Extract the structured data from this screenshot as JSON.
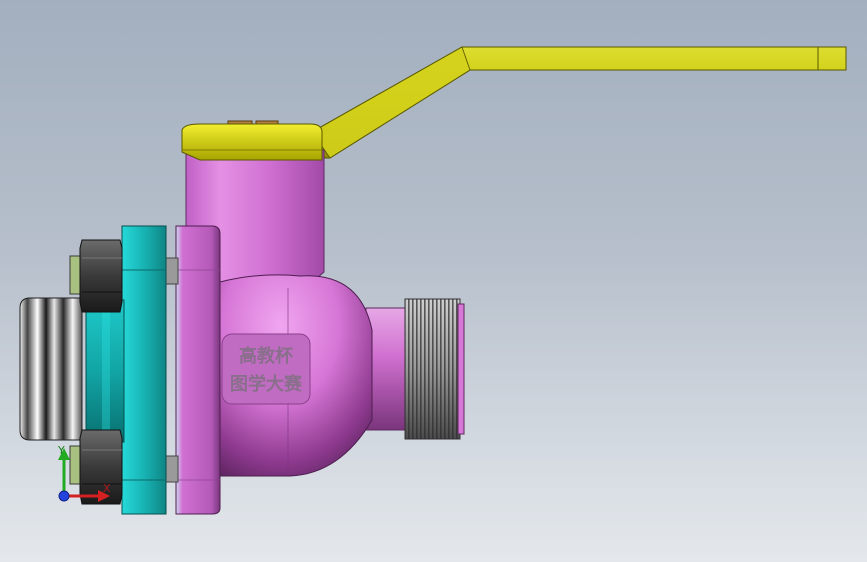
{
  "viewport": {
    "background_top": "#a3afbf",
    "background_bottom": "#e4e8ec"
  },
  "model": {
    "name": "ball-valve",
    "colors": {
      "handle": "#c4c200",
      "body": "#d777d6",
      "flange": "#19b8b8",
      "nut": "#3b3b3b",
      "thread": "#a0a0a0"
    },
    "embossed_text": {
      "line1": "高教杯",
      "line2": "图学大赛"
    }
  },
  "triad": {
    "y_label": "Y",
    "x_label": "X",
    "y_color": "#22aa22",
    "x_color": "#d42020",
    "z_color": "#2244dd"
  }
}
